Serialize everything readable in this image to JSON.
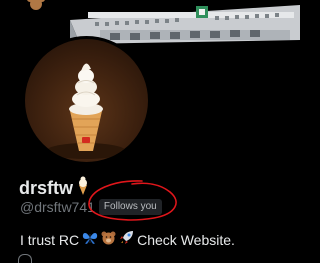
{
  "profile": {
    "display_name": "drsftw",
    "name_emoji_icon": "ice-cream-cone-icon",
    "handle": "@drsftw741",
    "follows_you": "Follows you",
    "bio_prefix": "I trust RC",
    "bio_icons": [
      "butterfly-icon",
      "teddy-bear-icon",
      "rocket-icon"
    ],
    "bio_suffix": "Check Website."
  },
  "colors": {
    "background": "#000000",
    "text_primary": "#e7e9ea",
    "text_secondary": "#71767b",
    "badge_bg": "#202327",
    "annotation_red": "#e0161b"
  }
}
